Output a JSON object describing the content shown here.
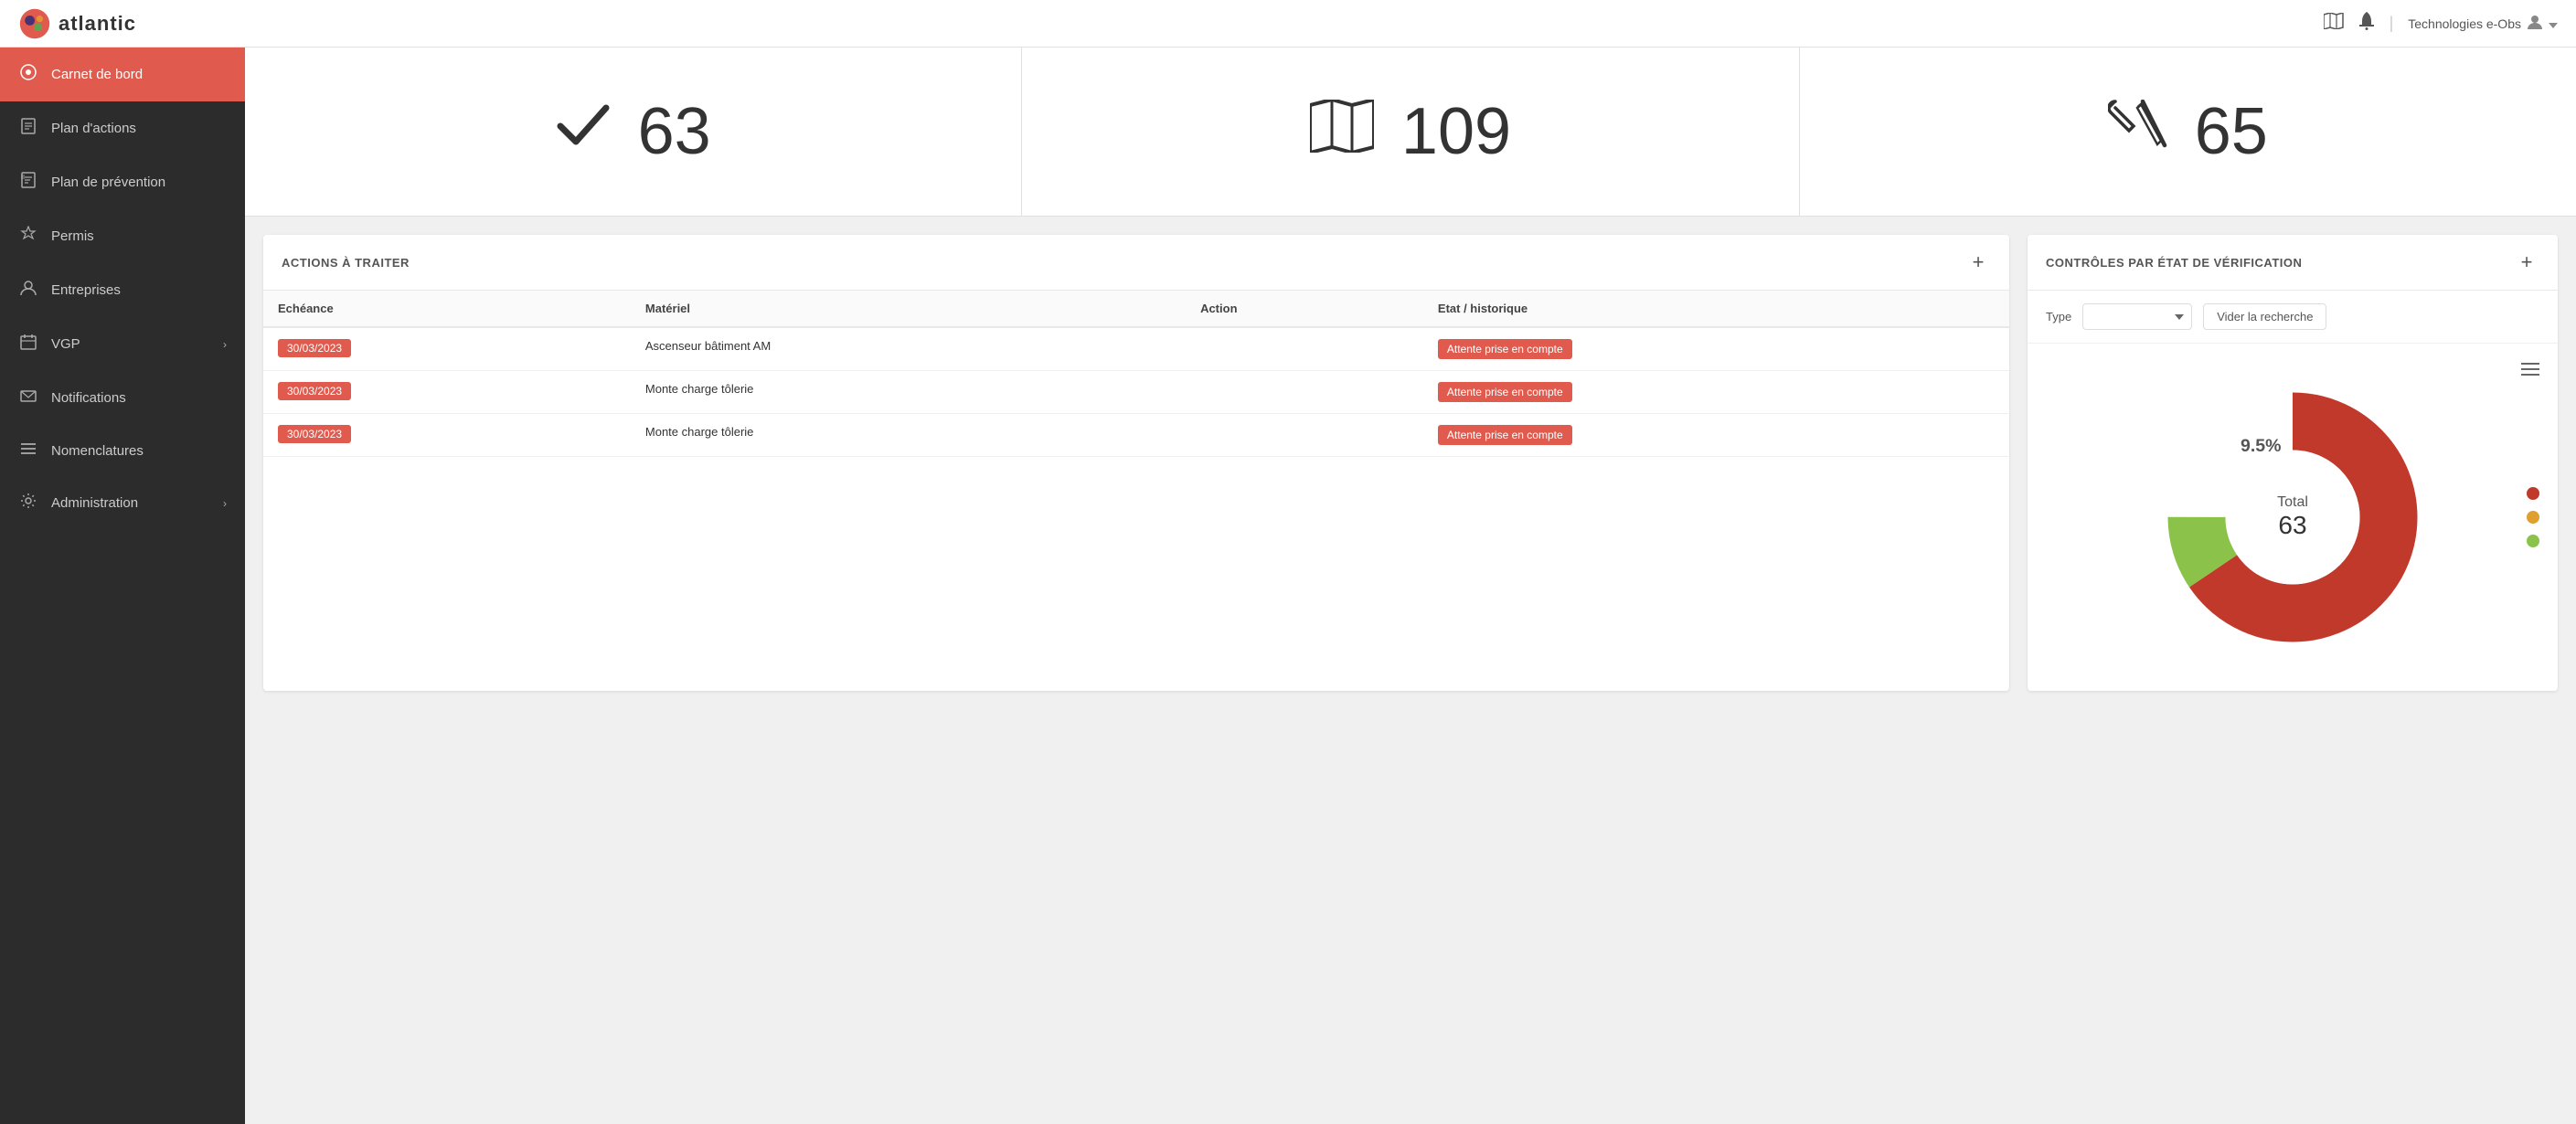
{
  "header": {
    "logo_text": "atlantic",
    "user_text": "Technologies e-Obs",
    "map_icon": "🗺",
    "bell_icon": "🔔"
  },
  "sidebar": {
    "items": [
      {
        "id": "carnet-de-bord",
        "label": "Carnet de bord",
        "icon": "⊙",
        "active": true,
        "has_chevron": false
      },
      {
        "id": "plan-actions",
        "label": "Plan d'actions",
        "icon": "📋",
        "active": false,
        "has_chevron": false
      },
      {
        "id": "plan-prevention",
        "label": "Plan de prévention",
        "icon": "📄",
        "active": false,
        "has_chevron": false
      },
      {
        "id": "permis",
        "label": "Permis",
        "icon": "🔥",
        "active": false,
        "has_chevron": false
      },
      {
        "id": "entreprises",
        "label": "Entreprises",
        "icon": "👤",
        "active": false,
        "has_chevron": false
      },
      {
        "id": "vgp",
        "label": "VGP",
        "icon": "📅",
        "active": false,
        "has_chevron": true
      },
      {
        "id": "notifications",
        "label": "Notifications",
        "icon": "✉",
        "active": false,
        "has_chevron": false
      },
      {
        "id": "nomenclatures",
        "label": "Nomenclatures",
        "icon": "☰",
        "active": false,
        "has_chevron": false
      },
      {
        "id": "administration",
        "label": "Administration",
        "icon": "⚙",
        "active": false,
        "has_chevron": true
      }
    ]
  },
  "stats": [
    {
      "id": "check",
      "icon": "✓",
      "value": "63"
    },
    {
      "id": "map",
      "icon": "map",
      "value": "109"
    },
    {
      "id": "tools",
      "icon": "tools",
      "value": "65"
    }
  ],
  "actions_panel": {
    "title": "ACTIONS À TRAITER",
    "add_label": "+",
    "columns": [
      "Echéance",
      "Matériel",
      "Action",
      "Etat / historique"
    ],
    "rows": [
      {
        "date": "30/03/2023",
        "materiel": "Ascenseur bâtiment AM",
        "action": "",
        "status": "Attente prise en compte"
      },
      {
        "date": "30/03/2023",
        "materiel": "Monte charge tôlerie",
        "action": "",
        "status": "Attente prise en compte"
      },
      {
        "date": "30/03/2023",
        "materiel": "Monte charge tôlerie",
        "action": "",
        "status": "Attente prise en compte"
      }
    ]
  },
  "controles_panel": {
    "title": "CONTRÔLES PAR ÉTAT DE VÉRIFICATION",
    "add_label": "+",
    "filter_label": "Type",
    "filter_placeholder": "",
    "clear_btn_label": "Vider la recherche",
    "chart": {
      "total_label": "Total",
      "total_value": "63",
      "segments": [
        {
          "color": "#c0392b",
          "pct": 90.5,
          "label": "red"
        },
        {
          "color": "#8bc34a",
          "pct": 9.5,
          "label": "green",
          "show_pct": "9.5%"
        }
      ]
    }
  }
}
